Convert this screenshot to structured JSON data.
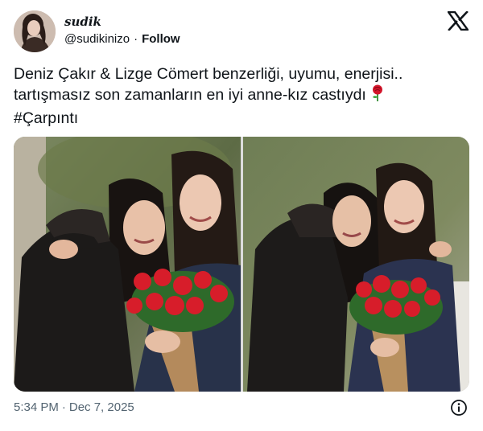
{
  "author": {
    "display_name": "sudik",
    "handle": "@sudikinizo",
    "separator": "·",
    "follow_label": "Follow"
  },
  "brand_icon": "x-logo-icon",
  "tweet": {
    "line1": "Deniz Çakır & Lizge Cömert benzerliği, uyumu, enerjisi..",
    "line2": "tartışmasız son zamanların en iyi anne-kız castıydı",
    "emoji": "rose-icon",
    "hashtag": "#Çarpıntı"
  },
  "media": {
    "count": 2,
    "photo1": "two women smiling and hugging, holding red carnations",
    "photo2": "two women smiling and hugging, holding red carnations"
  },
  "footer": {
    "time": "5:34 PM",
    "separator": "·",
    "date": "Dec 7, 2025",
    "info_icon": "info-icon"
  },
  "colors": {
    "text": "#0f1419",
    "secondary": "#536471",
    "rose": "#d4142a"
  }
}
